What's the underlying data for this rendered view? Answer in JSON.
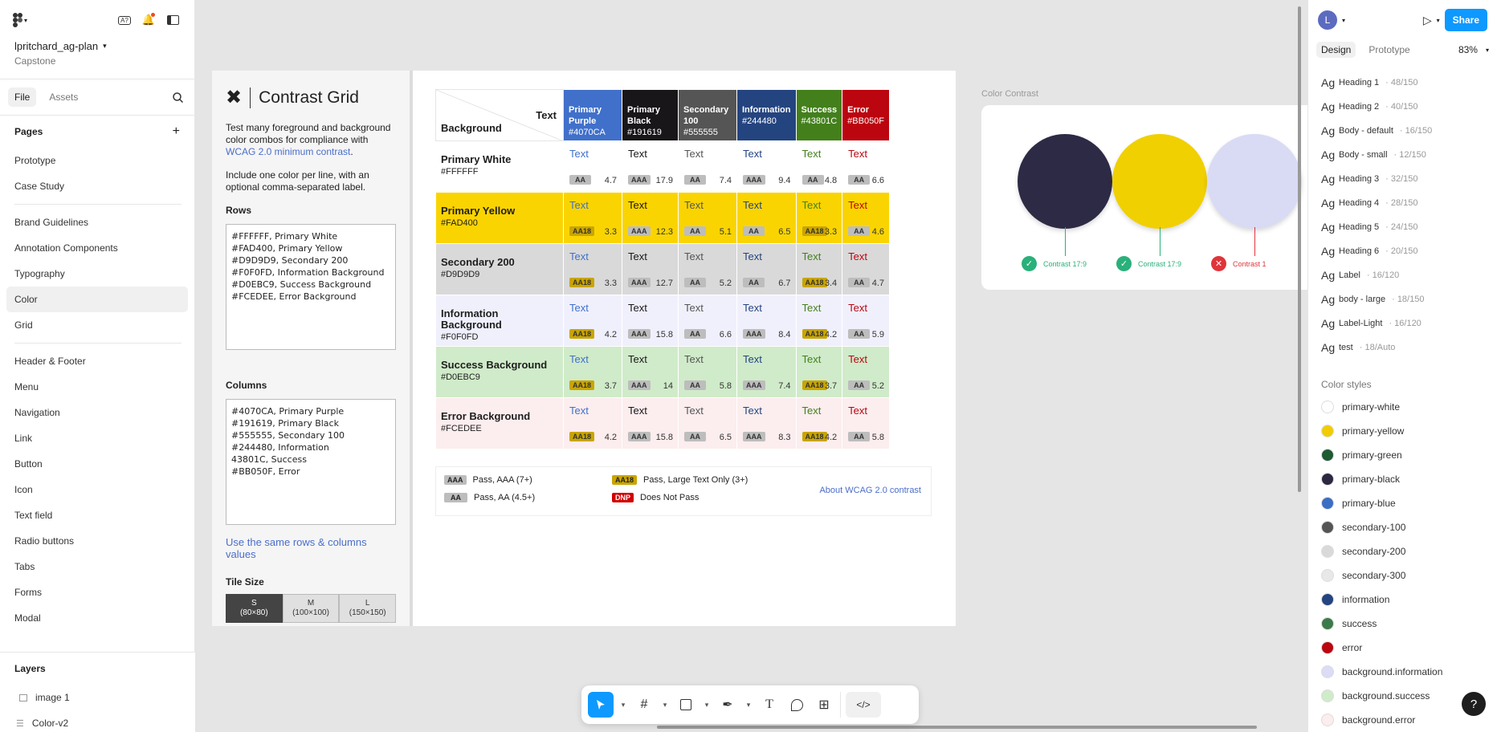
{
  "left": {
    "project_name": "lpritchard_ag-plan",
    "project_sub": "Capstone",
    "tabs": [
      "File",
      "Assets"
    ],
    "pages_title": "Pages",
    "pages": [
      "Prototype",
      "Case Study",
      "Brand Guidelines",
      "Annotation Components",
      "Typography",
      "Color",
      "Grid",
      "Header & Footer",
      "Menu",
      "Navigation",
      "Link",
      "Button",
      "Icon",
      "Text field",
      "Radio buttons",
      "Tabs",
      "Forms",
      "Modal"
    ],
    "selected_page": "Color",
    "layers_title": "Layers",
    "layers": [
      "image 1",
      "Color-v2"
    ]
  },
  "plugin": {
    "title": "Contrast Grid",
    "desc1": "Test many foreground and background color combos for compliance with ",
    "desc1_link": "WCAG 2.0 minimum contrast",
    "desc1_end": ".",
    "desc2": "Include one color per line, with an optional comma-separated label.",
    "rows_label": "Rows",
    "rows_value": "#FFFFFF, Primary White\n#FAD400, Primary Yellow\n#D9D9D9, Secondary 200\n#F0F0FD, Information Background\n#D0EBC9, Success Background\n#FCEDEE, Error Background",
    "columns_label": "Columns",
    "columns_value": "#4070CA, Primary Purple\n#191619, Primary Black\n#555555, Secondary 100\n#244480, Information\n43801C, Success\n#BB050F, Error",
    "same_link": "Use the same rows & columns values",
    "tile_label": "Tile Size",
    "tiles": [
      {
        "size": "S",
        "dim": "(80×80)"
      },
      {
        "size": "M",
        "dim": "(100×100)"
      },
      {
        "size": "L",
        "dim": "(150×150)"
      }
    ]
  },
  "grid": {
    "corner_top": "Text",
    "corner_bottom": "Background",
    "columns": [
      {
        "name": "Primary Purple",
        "hex": "#4070CA",
        "color": "#4070CA",
        "fg": "#ffffff"
      },
      {
        "name": "Primary Black",
        "hex": "#191619",
        "color": "#191619",
        "fg": "#ffffff"
      },
      {
        "name": "Secondary 100",
        "hex": "#555555",
        "color": "#555555",
        "fg": "#ffffff"
      },
      {
        "name": "Information",
        "hex": "#244480",
        "color": "#244480",
        "fg": "#ffffff"
      },
      {
        "name": "Success",
        "hex": "#43801C",
        "color": "#43801C",
        "fg": "#ffffff"
      },
      {
        "name": "Error",
        "hex": "#BB050F",
        "color": "#BB050F",
        "fg": "#ffffff"
      }
    ],
    "rows": [
      {
        "name": "Primary White",
        "hex": "#FFFFFF",
        "color": "#FFFFFF",
        "cells": [
          {
            "badge": "AA",
            "ratio": "4.7"
          },
          {
            "badge": "AAA",
            "ratio": "17.9"
          },
          {
            "badge": "AA",
            "ratio": "7.4"
          },
          {
            "badge": "AAA",
            "ratio": "9.4"
          },
          {
            "badge": "AA",
            "ratio": "4.8"
          },
          {
            "badge": "AA",
            "ratio": "6.6"
          }
        ]
      },
      {
        "name": "Primary Yellow",
        "hex": "#FAD400",
        "color": "#FAD400",
        "cells": [
          {
            "badge": "AA18",
            "ratio": "3.3"
          },
          {
            "badge": "AAA",
            "ratio": "12.3"
          },
          {
            "badge": "AA",
            "ratio": "5.1"
          },
          {
            "badge": "AA",
            "ratio": "6.5"
          },
          {
            "badge": "AA18",
            "ratio": "3.3"
          },
          {
            "badge": "AA",
            "ratio": "4.6"
          }
        ]
      },
      {
        "name": "Secondary 200",
        "hex": "#D9D9D9",
        "color": "#D9D9D9",
        "cells": [
          {
            "badge": "AA18",
            "ratio": "3.3"
          },
          {
            "badge": "AAA",
            "ratio": "12.7"
          },
          {
            "badge": "AA",
            "ratio": "5.2"
          },
          {
            "badge": "AA",
            "ratio": "6.7"
          },
          {
            "badge": "AA18",
            "ratio": "3.4"
          },
          {
            "badge": "AA",
            "ratio": "4.7"
          }
        ]
      },
      {
        "name": "Information Background",
        "hex": "#F0F0FD",
        "color": "#F0F0FD",
        "cells": [
          {
            "badge": "AA18",
            "ratio": "4.2"
          },
          {
            "badge": "AAA",
            "ratio": "15.8"
          },
          {
            "badge": "AA",
            "ratio": "6.6"
          },
          {
            "badge": "AAA",
            "ratio": "8.4"
          },
          {
            "badge": "AA18",
            "ratio": "4.2"
          },
          {
            "badge": "AA",
            "ratio": "5.9"
          }
        ]
      },
      {
        "name": "Success Background",
        "hex": "#D0EBC9",
        "color": "#D0EBC9",
        "cells": [
          {
            "badge": "AA18",
            "ratio": "3.7"
          },
          {
            "badge": "AAA",
            "ratio": "14"
          },
          {
            "badge": "AA",
            "ratio": "5.8"
          },
          {
            "badge": "AAA",
            "ratio": "7.4"
          },
          {
            "badge": "AA18",
            "ratio": "3.7"
          },
          {
            "badge": "AA",
            "ratio": "5.2"
          }
        ]
      },
      {
        "name": "Error Background",
        "hex": "#FCEDEE",
        "color": "#FCEDEE",
        "cells": [
          {
            "badge": "AA18",
            "ratio": "4.2"
          },
          {
            "badge": "AAA",
            "ratio": "15.8"
          },
          {
            "badge": "AA",
            "ratio": "6.5"
          },
          {
            "badge": "AAA",
            "ratio": "8.3"
          },
          {
            "badge": "AA18",
            "ratio": "4.2"
          },
          {
            "badge": "AA",
            "ratio": "5.8"
          }
        ]
      }
    ],
    "cell_text": "Text"
  },
  "legend": {
    "aaa": "Pass, AAA (7+)",
    "aa": "Pass, AA (4.5+)",
    "aa18": "Pass, Large Text Only (3+)",
    "dnp": "Does Not Pass",
    "link": "About WCAG 2.0 contrast",
    "badge_aaa": "AAA",
    "badge_aa": "AA",
    "badge_aa18": "AA18",
    "badge_dnp": "DNP"
  },
  "contrast": {
    "label": "Color Contrast",
    "items": [
      {
        "color": "#2d2a45",
        "ok": true,
        "text": "Contrast 17:9"
      },
      {
        "color": "#f0d000",
        "ok": true,
        "text": "Contrast 17:9"
      },
      {
        "color": "#d9dbf5",
        "ok": false,
        "text": "Contrast 1"
      }
    ]
  },
  "right": {
    "avatar": "L",
    "share": "Share",
    "tabs": [
      "Design",
      "Prototype"
    ],
    "zoom": "83%",
    "text_styles": [
      {
        "name": "Heading 1",
        "meta": "· 48/150"
      },
      {
        "name": "Heading 2",
        "meta": "· 40/150"
      },
      {
        "name": "Body - default",
        "meta": "· 16/150"
      },
      {
        "name": "Body - small",
        "meta": "· 12/150"
      },
      {
        "name": "Heading 3",
        "meta": "· 32/150"
      },
      {
        "name": "Heading 4",
        "meta": "· 28/150"
      },
      {
        "name": "Heading 5",
        "meta": "· 24/150"
      },
      {
        "name": "Heading 6",
        "meta": "· 20/150"
      },
      {
        "name": "Label",
        "meta": "· 16/120"
      },
      {
        "name": "body - large",
        "meta": "· 18/150"
      },
      {
        "name": "Label-Light",
        "meta": "· 16/120"
      },
      {
        "name": "test",
        "meta": "· 18/Auto"
      }
    ],
    "color_styles_title": "Color styles",
    "color_styles": [
      {
        "name": "primary-white",
        "color": "#ffffff"
      },
      {
        "name": "primary-yellow",
        "color": "#f2cc00"
      },
      {
        "name": "primary-green",
        "color": "#1e5a32"
      },
      {
        "name": "primary-black",
        "color": "#2a2940"
      },
      {
        "name": "primary-blue",
        "color": "#3a6ec4"
      },
      {
        "name": "secondary-100",
        "color": "#555555"
      },
      {
        "name": "secondary-200",
        "color": "#d9d9d9"
      },
      {
        "name": "secondary-300",
        "color": "#e8e8e8"
      },
      {
        "name": "information",
        "color": "#244480"
      },
      {
        "name": "success",
        "color": "#3c7a4a"
      },
      {
        "name": "error",
        "color": "#bb050f"
      },
      {
        "name": "background.information",
        "color": "#dcdcf7"
      },
      {
        "name": "background.success",
        "color": "#d0ebc9"
      },
      {
        "name": "background.error",
        "color": "#fcedee"
      }
    ],
    "help": "?"
  }
}
